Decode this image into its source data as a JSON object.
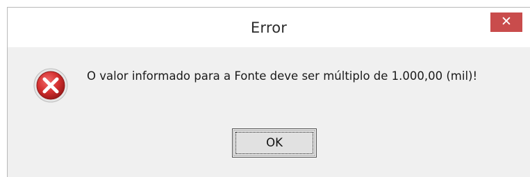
{
  "dialog": {
    "title": "Error",
    "close_icon": "close-icon",
    "icon": "error-icon",
    "message": "O valor informado para a Fonte deve ser múltiplo de 1.000,00 (mil)!",
    "ok_label": "OK"
  },
  "colors": {
    "close_button": "#c94c4c",
    "dialog_background": "#f0f0f0",
    "error_icon": "#d32f2f"
  }
}
